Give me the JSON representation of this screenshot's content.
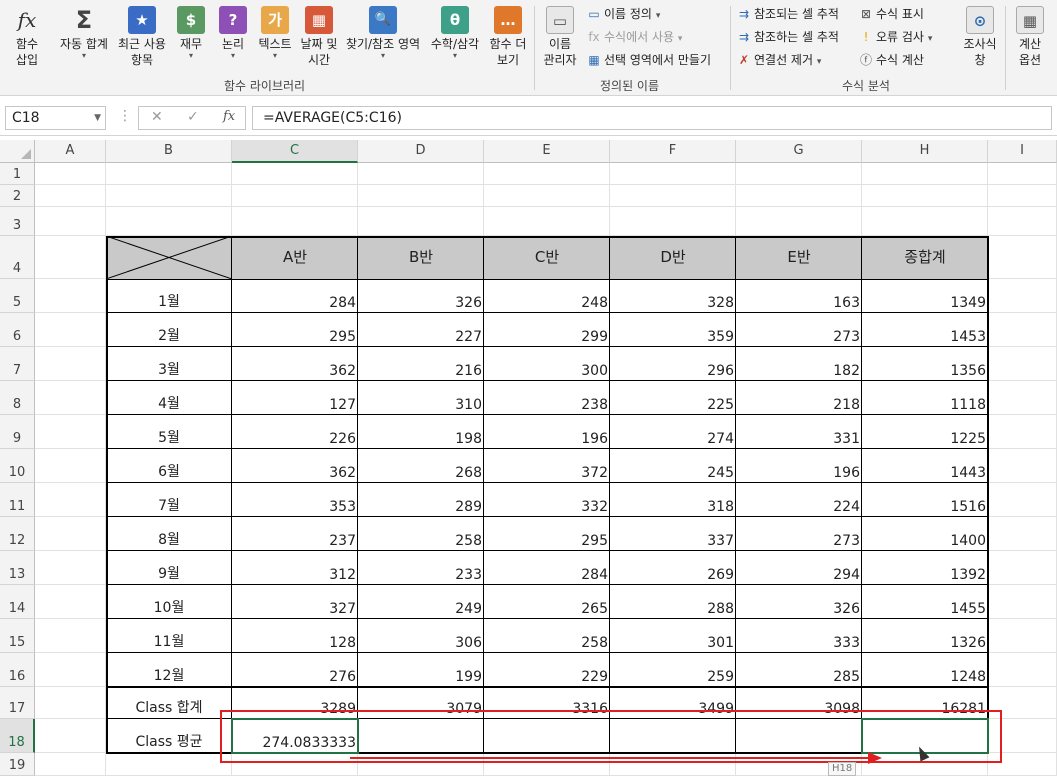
{
  "ribbon": {
    "insert_function": {
      "icon": "fx",
      "line1": "함수",
      "line2": "삽입"
    },
    "autosum": {
      "icon": "Σ",
      "label": "자동 합계"
    },
    "recent": {
      "icon": "★",
      "line1": "최근 사용",
      "line2": "항목"
    },
    "financial": {
      "icon": "$",
      "label": "재무"
    },
    "logical": {
      "icon": "?",
      "label": "논리"
    },
    "text": {
      "icon": "가",
      "label": "텍스트"
    },
    "datetime": {
      "icon": "▦",
      "line1": "날짜 및",
      "line2": "시간"
    },
    "lookup": {
      "icon": "🔍",
      "label": "찾기/참조 영역"
    },
    "math": {
      "icon": "θ",
      "label": "수학/삼각"
    },
    "more": {
      "icon": "…",
      "line1": "함수 더",
      "line2": "보기"
    },
    "name_manager": {
      "line1": "이름",
      "line2": "관리자"
    },
    "define_name": "이름 정의",
    "use_in_formula": "수식에서 사용",
    "create_from_selection": "선택 영역에서 만들기",
    "trace_precedents": "참조되는 셀 추적",
    "trace_dependents": "참조하는 셀 추적",
    "remove_arrows": "연결선 제거",
    "show_formulas": "수식 표시",
    "error_checking": "오류 검사",
    "evaluate_formula": "수식 계산",
    "watch_window": {
      "line1": "조사식",
      "line2": "창"
    },
    "calc_options": {
      "line1": "계산",
      "line2": "옵션"
    },
    "group_function_library": "함수 라이브러리",
    "group_defined_names": "정의된 이름",
    "group_formula_auditing": "수식 분석"
  },
  "formula_bar": {
    "name_box": "C18",
    "cancel_icon": "✕",
    "enter_icon": "✓",
    "fx_icon": "fx",
    "formula": "=AVERAGE(C5:C16)"
  },
  "columns": [
    "A",
    "B",
    "C",
    "D",
    "E",
    "F",
    "G",
    "H",
    "I"
  ],
  "rows": [
    "1",
    "2",
    "3",
    "4",
    "5",
    "6",
    "7",
    "8",
    "9",
    "10",
    "11",
    "12",
    "13",
    "14",
    "15",
    "16",
    "17",
    "18",
    "19"
  ],
  "table": {
    "headers": [
      "A반",
      "B반",
      "C반",
      "D반",
      "E반",
      "종합계"
    ],
    "months": [
      "1월",
      "2월",
      "3월",
      "4월",
      "5월",
      "6월",
      "7월",
      "8월",
      "9월",
      "10월",
      "11월",
      "12월"
    ],
    "values": [
      [
        "284",
        "326",
        "248",
        "328",
        "163",
        "1349"
      ],
      [
        "295",
        "227",
        "299",
        "359",
        "273",
        "1453"
      ],
      [
        "362",
        "216",
        "300",
        "296",
        "182",
        "1356"
      ],
      [
        "127",
        "310",
        "238",
        "225",
        "218",
        "1118"
      ],
      [
        "226",
        "198",
        "196",
        "274",
        "331",
        "1225"
      ],
      [
        "362",
        "268",
        "372",
        "245",
        "196",
        "1443"
      ],
      [
        "353",
        "289",
        "332",
        "318",
        "224",
        "1516"
      ],
      [
        "237",
        "258",
        "295",
        "337",
        "273",
        "1400"
      ],
      [
        "312",
        "233",
        "284",
        "269",
        "294",
        "1392"
      ],
      [
        "327",
        "249",
        "265",
        "288",
        "326",
        "1455"
      ],
      [
        "128",
        "306",
        "258",
        "301",
        "333",
        "1326"
      ],
      [
        "276",
        "199",
        "229",
        "259",
        "285",
        "1248"
      ]
    ],
    "total_label": "Class 합계",
    "totals": [
      "3289",
      "3079",
      "3316",
      "3499",
      "3098",
      "16281"
    ],
    "avg_label": "Class 평균",
    "averages": [
      "274.0833333",
      "",
      "",
      "",
      "",
      ""
    ]
  },
  "fill_tooltip": "H18",
  "colors": {
    "excel_green": "#217346",
    "annotation_red": "#e02020",
    "header_fill": "#c9c9c9"
  }
}
